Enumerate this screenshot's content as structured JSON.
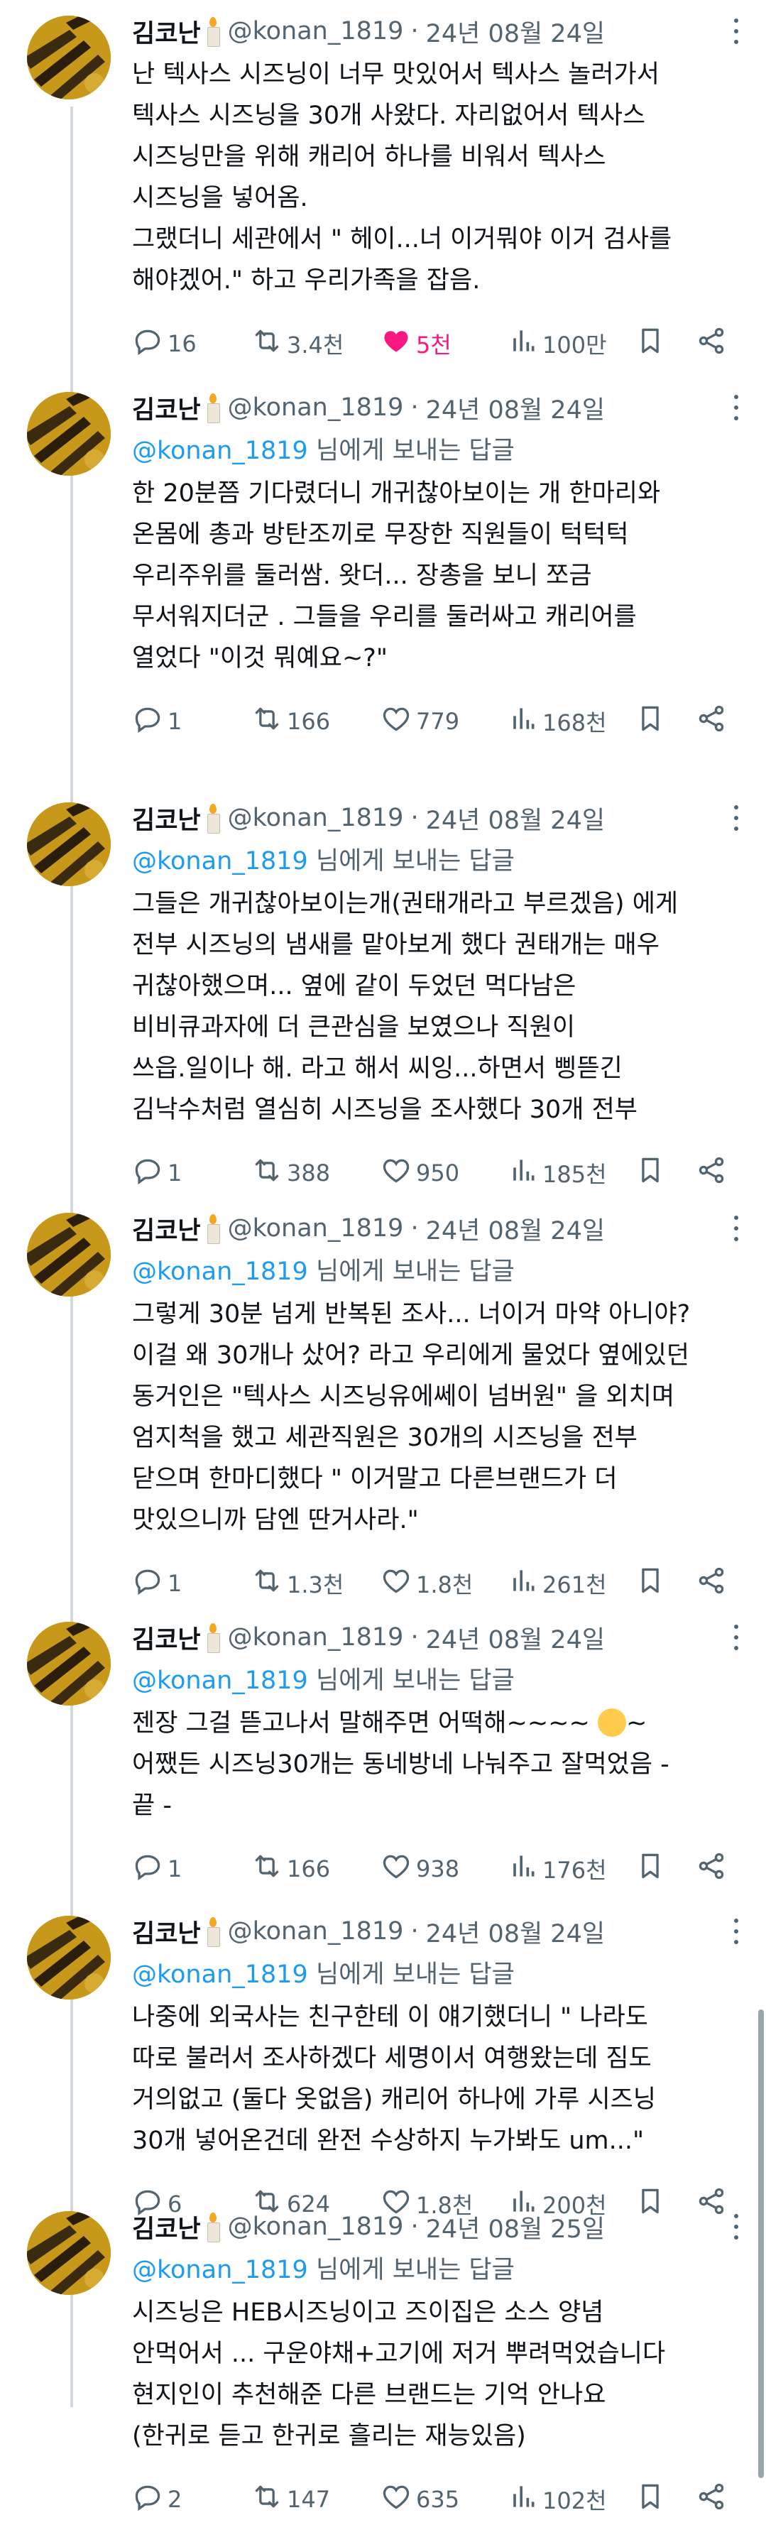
{
  "author": {
    "name": "김코난",
    "handle": "@konan_1819",
    "separator": "·"
  },
  "reply_prefix": "님에게 보내는 답글",
  "tweets": [
    {
      "date": "24년 08월 24일",
      "reply_to": "",
      "lines": [
        "난 텍사스 시즈닝이 너무 맛있어서 텍사스 놀러가서",
        "텍사스 시즈닝을 30개 사왔다. 자리없어서 텍사스",
        "시즈닝만을 위해 캐리어 하나를 비워서 텍사스",
        "시즈닝을 넣어옴.",
        "그랬더니 세관에서 \" 헤이...너 이거뭐야 이거 검사를",
        "해야겠어.\" 하고 우리가족을 잡음."
      ],
      "replies": "16",
      "retweets": "3.4천",
      "likes": "5천",
      "views": "100만",
      "liked": true
    },
    {
      "date": "24년 08월 24일",
      "reply_to": "@konan_1819",
      "lines": [
        "한 20분쯤 기다렸더니 개귀찮아보이는 개 한마리와",
        "온몸에 총과 방탄조끼로 무장한 직원들이 턱턱턱",
        "우리주위를 둘러쌈. 왓더... 장총을 보니 쪼금",
        "무서워지더군 . 그들을 우리를 둘러싸고 캐리어를",
        "열었다 \"이것 뭐예요~?\""
      ],
      "replies": "1",
      "retweets": "166",
      "likes": "779",
      "views": "168천",
      "liked": false
    },
    {
      "date": "24년 08월 24일",
      "reply_to": "@konan_1819",
      "lines": [
        "그들은 개귀찮아보이는개(권태개라고 부르겠음) 에게",
        "전부 시즈닝의 냄새를 맡아보게 했다 권태개는 매우",
        "귀찮아했으며... 옆에 같이 두었던 먹다남은",
        "비비큐과자에 더 큰관심을 보였으나 직원이",
        "쓰읍.일이나 해. 라고 해서 씨잉...하면서 삥뜯긴",
        "김낙수처럼 열심히 시즈닝을 조사했다 30개 전부"
      ],
      "replies": "1",
      "retweets": "388",
      "likes": "950",
      "views": "185천",
      "liked": false
    },
    {
      "date": "24년 08월 24일",
      "reply_to": "@konan_1819",
      "lines": [
        "그렇게 30분 넘게 반복된 조사... 너이거 마약 아니야?",
        "이걸 왜 30개나 샀어? 라고 우리에게 물었다 옆에있던",
        "동거인은 \"텍사스 시즈닝유에쎄이 넘버원\" 을 외치며",
        "엄지척을 했고 세관직원은 30개의 시즈닝을 전부",
        "닫으며 한마디했다 \" 이거말고 다른브랜드가 더",
        "맛있으니까 담엔 딴거사라.\""
      ],
      "replies": "1",
      "retweets": "1.3천",
      "likes": "1.8천",
      "views": "261천",
      "liked": false
    },
    {
      "date": "24년 08월 24일",
      "reply_to": "@konan_1819",
      "lines": [
        "젠장 그걸 뜯고나서 말해주면 어떡해~~~~ [[FACE]]~",
        "어쨌든 시즈닝30개는 동네방네 나눠주고 잘먹었음 -",
        "끝 -"
      ],
      "replies": "1",
      "retweets": "166",
      "likes": "938",
      "views": "176천",
      "liked": false
    },
    {
      "date": "24년 08월 24일",
      "reply_to": "@konan_1819",
      "lines": [
        "나중에 외국사는 친구한테 이 얘기했더니 \" 나라도",
        "따로 불러서 조사하겠다 세명이서 여행왔는데 짐도",
        "거의없고 (둘다 옷없음) 캐리어 하나에 가루 시즈닝",
        "30개 넣어온건데 완전 수상하지 누가봐도 um...\""
      ],
      "replies": "6",
      "retweets": "624",
      "likes": "1.8천",
      "views": "200천",
      "liked": false
    },
    {
      "date": "24년 08월 25일",
      "reply_to": "@konan_1819",
      "lines": [
        "시즈닝은 HEB시즈닝이고 즈이집은 소스 양념",
        "안먹어서 ... 구운야채+고기에 저거 뿌려먹었습니다",
        "현지인이 추천해준 다른 브랜드는 기억 안나요",
        "(한귀로 듣고 한귀로 흘리는 재능있음)"
      ],
      "replies": "2",
      "retweets": "147",
      "likes": "635",
      "views": "102천",
      "liked": false
    }
  ]
}
